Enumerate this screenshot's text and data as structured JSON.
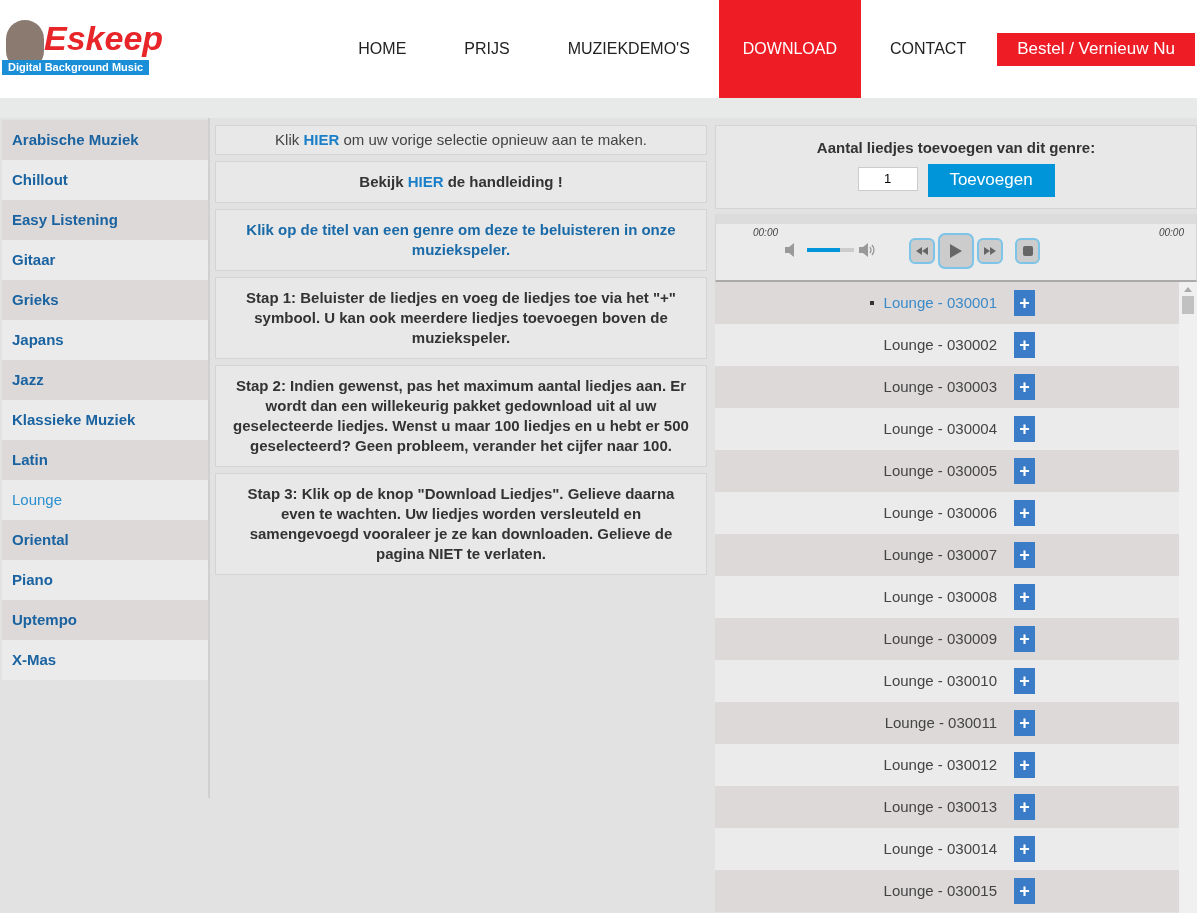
{
  "logo": {
    "name": "Eskeep",
    "tagline": "Digital Background Music"
  },
  "nav": [
    {
      "label": "HOME",
      "selected": false
    },
    {
      "label": "PRIJS",
      "selected": false
    },
    {
      "label": "MUZIEKDEMO'S",
      "selected": false
    },
    {
      "label": "DOWNLOAD",
      "selected": true
    },
    {
      "label": "CONTACT",
      "selected": false
    }
  ],
  "order_button": "Bestel / Vernieuw Nu",
  "genres": [
    {
      "label": "Arabische Muziek",
      "selected": false
    },
    {
      "label": "Chillout",
      "selected": false
    },
    {
      "label": "Easy Listening",
      "selected": false
    },
    {
      "label": "Gitaar",
      "selected": false
    },
    {
      "label": "Grieks",
      "selected": false
    },
    {
      "label": "Japans",
      "selected": false
    },
    {
      "label": "Jazz",
      "selected": false
    },
    {
      "label": "Klassieke Muziek",
      "selected": false
    },
    {
      "label": "Latin",
      "selected": false
    },
    {
      "label": "Lounge",
      "selected": true
    },
    {
      "label": "Oriental",
      "selected": false
    },
    {
      "label": "Piano",
      "selected": false
    },
    {
      "label": "Uptempo",
      "selected": false
    },
    {
      "label": "X-Mas",
      "selected": false
    }
  ],
  "notices": [
    {
      "kind": "link",
      "bold": false,
      "before": "Klik ",
      "link": "HIER",
      "after": " om uw vorige selectie opnieuw aan te maken."
    },
    {
      "kind": "link",
      "bold": true,
      "before": "Bekijk ",
      "link": "HIER",
      "after": " de handleiding !"
    },
    {
      "kind": "info",
      "text": "Klik op de titel van een genre om deze te beluisteren in onze muziekspeler."
    },
    {
      "kind": "step",
      "text": "Stap 1: Beluister de liedjes en voeg de liedjes toe via het \"+\" symbool. U kan ook meerdere liedjes toevoegen boven de muziekspeler."
    },
    {
      "kind": "step",
      "text": "Stap 2: Indien gewenst, pas het maximum aantal liedjes aan. Er wordt dan een willekeurig pakket gedownload uit al uw geselecteerde liedjes. Wenst u maar 100 liedjes en u hebt er 500 geselecteerd? Geen probleem, verander het cijfer naar 100."
    },
    {
      "kind": "step",
      "text": "Stap 3: Klik op de knop \"Download Liedjes\". Gelieve daarna even te wachten. Uw liedjes worden versleuteld en samengevoegd vooraleer je ze kan downloaden. Gelieve de pagina NIET te verlaten."
    }
  ],
  "add_panel": {
    "label": "Aantal liedjes toevoegen van dit genre:",
    "value": "1",
    "button": "Toevoegen"
  },
  "player": {
    "time_elapsed": "00:00",
    "time_total": "00:00",
    "volume": {
      "level": 0.7
    }
  },
  "tracks": [
    {
      "title": "Lounge - 030001",
      "selected": true,
      "add": "+"
    },
    {
      "title": "Lounge - 030002",
      "selected": false,
      "add": "+"
    },
    {
      "title": "Lounge - 030003",
      "selected": false,
      "add": "+"
    },
    {
      "title": "Lounge - 030004",
      "selected": false,
      "add": "+"
    },
    {
      "title": "Lounge - 030005",
      "selected": false,
      "add": "+"
    },
    {
      "title": "Lounge - 030006",
      "selected": false,
      "add": "+"
    },
    {
      "title": "Lounge - 030007",
      "selected": false,
      "add": "+"
    },
    {
      "title": "Lounge - 030008",
      "selected": false,
      "add": "+"
    },
    {
      "title": "Lounge - 030009",
      "selected": false,
      "add": "+"
    },
    {
      "title": "Lounge - 030010",
      "selected": false,
      "add": "+"
    },
    {
      "title": "Lounge - 030011",
      "selected": false,
      "add": "+"
    },
    {
      "title": "Lounge - 030012",
      "selected": false,
      "add": "+"
    },
    {
      "title": "Lounge - 030013",
      "selected": false,
      "add": "+"
    },
    {
      "title": "Lounge - 030014",
      "selected": false,
      "add": "+"
    },
    {
      "title": "Lounge - 030015",
      "selected": false,
      "add": "+"
    }
  ]
}
